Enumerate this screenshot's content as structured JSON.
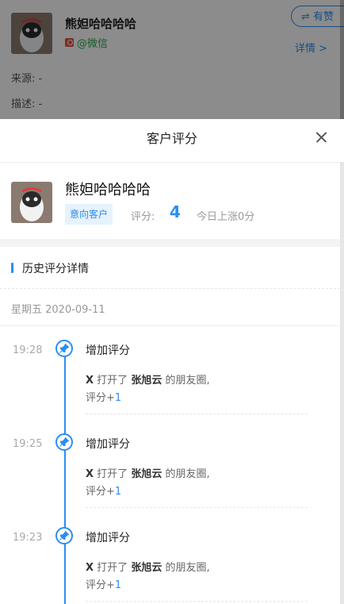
{
  "background": {
    "contact_name": "熊妲哈哈哈哈",
    "wechat_label": "@微信",
    "follow_button": "⇌ 有赞",
    "detail_link": "详情 >",
    "source_label": "来源: -",
    "desc_label": "描述: -"
  },
  "modal": {
    "title": "客户评分",
    "close_symbol": "×"
  },
  "customer": {
    "name": "熊妲哈哈哈哈",
    "tag": "意向客户",
    "score_label": "评分:",
    "score": "4",
    "today_change": "今日上涨0分"
  },
  "history": {
    "section_title": "历史评分详情",
    "date": "星期五 2020-09-11",
    "entries": [
      {
        "time": "19:28",
        "title": "增加评分",
        "line_prefix": "X",
        "action": "打开了",
        "target": "张旭云",
        "suffix": "的朋友圈,",
        "score_label": "评分+",
        "score_delta": "1"
      },
      {
        "time": "19:25",
        "title": "增加评分",
        "line_prefix": "X",
        "action": "打开了",
        "target": "张旭云",
        "suffix": "的朋友圈,",
        "score_label": "评分+",
        "score_delta": "1"
      },
      {
        "time": "19:23",
        "title": "增加评分",
        "line_prefix": "X",
        "action": "打开了",
        "target": "张旭云",
        "suffix": "的朋友圈,",
        "score_label": "评分+",
        "score_delta": "1"
      }
    ]
  },
  "colors": {
    "accent": "#2b8ef0",
    "wechat_green": "#27a84a",
    "tag_bg": "#e6f2fd"
  },
  "icons": {
    "pin": "pin-icon",
    "close": "close-icon",
    "avatar": "cat-avatar"
  }
}
